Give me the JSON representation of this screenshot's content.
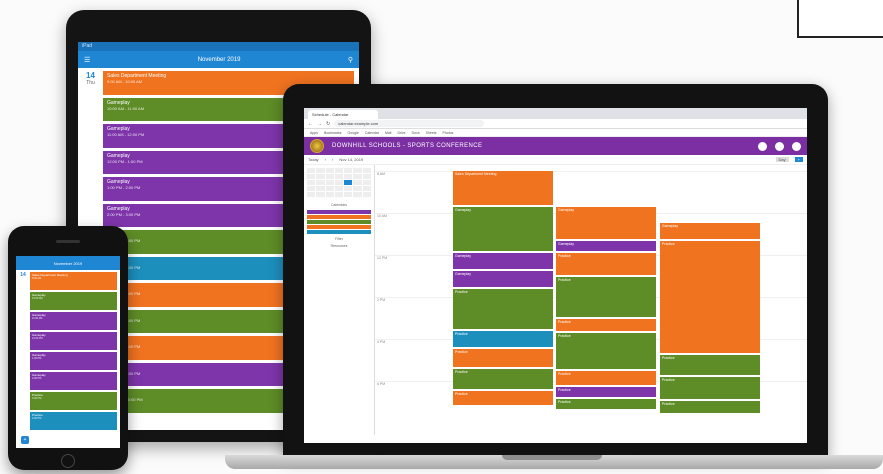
{
  "colors": {
    "orange": "#f07320",
    "green": "#5e8c27",
    "purple": "#7e35aa",
    "teal": "#1d8fbd",
    "brand_purple": "#7b2fa3",
    "app_blue": "#1f86d3"
  },
  "tablet": {
    "status_text": "iPad",
    "title": "November 2019",
    "date_num": "14",
    "weekday": "Thu",
    "events": [
      {
        "color": "orange",
        "title": "Sales Department Meeting",
        "sub": "9:00 AM - 10:00 AM"
      },
      {
        "color": "green",
        "title": "Gameplay",
        "sub": "10:00 AM - 11:00 AM"
      },
      {
        "color": "purple",
        "title": "Gameplay",
        "sub": "11:00 AM - 12:00 PM"
      },
      {
        "color": "purple",
        "title": "Gameplay",
        "sub": "12:00 PM - 1:00 PM"
      },
      {
        "color": "purple",
        "title": "Gameplay",
        "sub": "1:00 PM - 2:00 PM"
      },
      {
        "color": "purple",
        "title": "Gameplay",
        "sub": "2:00 PM - 3:00 PM"
      },
      {
        "color": "green",
        "title": "Practice",
        "sub": "3:00 PM - 4:00 PM"
      },
      {
        "color": "teal",
        "title": "Practice",
        "sub": "4:00 PM - 5:00 PM"
      },
      {
        "color": "orange",
        "title": "Practice",
        "sub": "5:00 PM - 6:00 PM"
      },
      {
        "color": "green",
        "title": "Practice",
        "sub": "6:00 PM - 7:00 PM"
      },
      {
        "color": "orange",
        "title": "Practice",
        "sub": "7:00 PM - 8:00 PM"
      },
      {
        "color": "purple",
        "title": "Practice",
        "sub": "8:00 PM - 9:00 PM"
      },
      {
        "color": "green",
        "title": "Practice",
        "sub": "9:00 PM - 10:00 PM"
      }
    ]
  },
  "phone": {
    "title": "November 2019",
    "date_num": "14",
    "events": [
      {
        "color": "orange",
        "title": "Sales Department Meeting",
        "sub": "9:00 AM"
      },
      {
        "color": "green",
        "title": "Gameplay",
        "sub": "10:00 AM"
      },
      {
        "color": "purple",
        "title": "Gameplay",
        "sub": "11:00 AM"
      },
      {
        "color": "purple",
        "title": "Gameplay",
        "sub": "12:00 PM"
      },
      {
        "color": "purple",
        "title": "Gameplay",
        "sub": "1:00 PM"
      },
      {
        "color": "purple",
        "title": "Gameplay",
        "sub": "2:00 PM"
      },
      {
        "color": "green",
        "title": "Practice",
        "sub": "3:00 PM"
      },
      {
        "color": "teal",
        "title": "Practice",
        "sub": "4:00 PM"
      }
    ]
  },
  "laptop": {
    "tab_title": "Schedule - Calendar",
    "url": "calendar.example.com",
    "bookmarks": [
      "Apps",
      "Bookmarks",
      "Google",
      "Calendar",
      "Mail",
      "Drive",
      "Docs",
      "Sheets",
      "Photos"
    ],
    "org_name": "DOWNHILL SCHOOLS - SPORTS CONFERENCE",
    "toolbar": {
      "today": "Today",
      "range": "Nov 14, 2019",
      "view": "Day",
      "new": "+"
    },
    "side_labels": [
      "Calendars",
      "Filter",
      "Resources"
    ],
    "legend_colors": [
      "purple",
      "orange",
      "green",
      "orange",
      "teal"
    ],
    "times": [
      "8 AM",
      "10 AM",
      "12 PM",
      "2 PM",
      "4 PM",
      "6 PM"
    ],
    "columns": [
      {
        "events": [
          {
            "color": "orange",
            "title": "Sales Department Meeting",
            "start": 0,
            "span": 34
          },
          {
            "color": "green",
            "title": "Gameplay",
            "start": 36,
            "span": 44
          },
          {
            "color": "purple",
            "title": "Gameplay",
            "start": 82,
            "span": 16
          },
          {
            "color": "purple",
            "title": "Gameplay",
            "start": 100,
            "span": 16
          },
          {
            "color": "green",
            "title": "Practice",
            "start": 118,
            "span": 40
          },
          {
            "color": "teal",
            "title": "Practice",
            "start": 160,
            "span": 16
          },
          {
            "color": "orange",
            "title": "Practice",
            "start": 178,
            "span": 18
          },
          {
            "color": "green",
            "title": "Practice",
            "start": 198,
            "span": 20
          },
          {
            "color": "orange",
            "title": "Practice",
            "start": 220,
            "span": 14
          }
        ]
      },
      {
        "events": [
          {
            "color": "orange",
            "title": "Gameplay",
            "start": 36,
            "span": 32
          },
          {
            "color": "purple",
            "title": "Gameplay",
            "start": 70,
            "span": 10
          },
          {
            "color": "orange",
            "title": "Practice",
            "start": 82,
            "span": 22
          },
          {
            "color": "green",
            "title": "Practice",
            "start": 106,
            "span": 40
          },
          {
            "color": "orange",
            "title": "Practice",
            "start": 148,
            "span": 12
          },
          {
            "color": "green",
            "title": "Practice",
            "start": 162,
            "span": 36
          },
          {
            "color": "orange",
            "title": "Practice",
            "start": 200,
            "span": 14
          },
          {
            "color": "purple",
            "title": "Practice",
            "start": 216,
            "span": 10
          },
          {
            "color": "green",
            "title": "Practice",
            "start": 228,
            "span": 10
          }
        ]
      },
      {
        "events": [
          {
            "color": "orange",
            "title": "Gameplay",
            "start": 52,
            "span": 16
          },
          {
            "color": "orange",
            "title": "Practice",
            "start": 70,
            "span": 112
          },
          {
            "color": "green",
            "title": "Practice",
            "start": 184,
            "span": 20
          },
          {
            "color": "green",
            "title": "Practice",
            "start": 206,
            "span": 22
          },
          {
            "color": "green",
            "title": "Practice",
            "start": 230,
            "span": 12
          }
        ]
      }
    ]
  }
}
